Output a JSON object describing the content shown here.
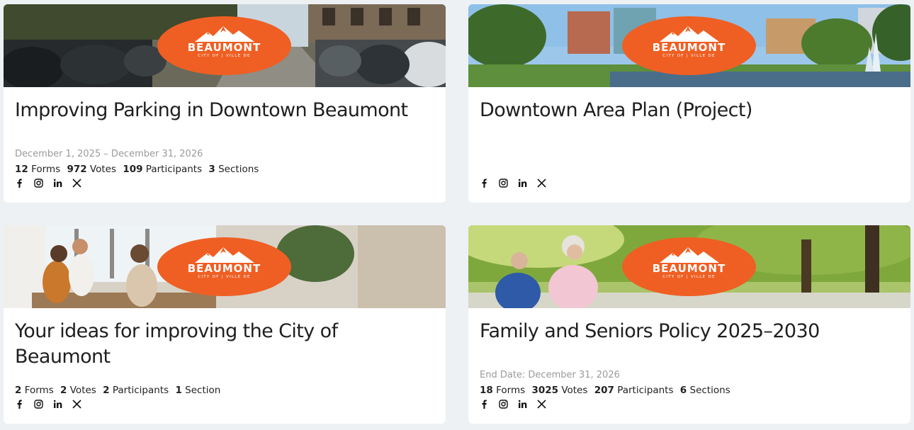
{
  "brand": {
    "name": "BEAUMONT",
    "tagline": "CITY OF | VILLE DE",
    "color": "#ef5f23"
  },
  "social_icons": [
    "facebook-icon",
    "instagram-icon",
    "linkedin-icon",
    "x-icon"
  ],
  "cards": [
    {
      "title": "Improving Parking in Downtown Beaumont",
      "dates": "December 1, 2025 – December 31, 2026",
      "stats": {
        "forms": "12",
        "forms_label": "Forms",
        "votes": "972",
        "votes_label": "Votes",
        "participants": "109",
        "participants_label": "Participants",
        "sections": "3",
        "sections_label": "Sections"
      },
      "banner": "street-with-parked-cars"
    },
    {
      "title": "Downtown Area Plan (Project)",
      "banner": "downtown-park-with-fountain"
    },
    {
      "title": "Your ideas for improving the City of Beaumont",
      "stats": {
        "forms": "2",
        "forms_label": "Forms",
        "votes": "2",
        "votes_label": "Votes",
        "participants": "2",
        "participants_label": "Participants",
        "sections": "1",
        "sections_label": "Section"
      },
      "banner": "people-meeting-at-table"
    },
    {
      "title": "Family and Seniors Policy 2025–2030",
      "dates": "End Date: December 31, 2026",
      "stats": {
        "forms": "18",
        "forms_label": "Forms",
        "votes": "3025",
        "votes_label": "Votes",
        "participants": "207",
        "participants_label": "Participants",
        "sections": "6",
        "sections_label": "Sections"
      },
      "banner": "seniors-jogging-in-park"
    }
  ]
}
